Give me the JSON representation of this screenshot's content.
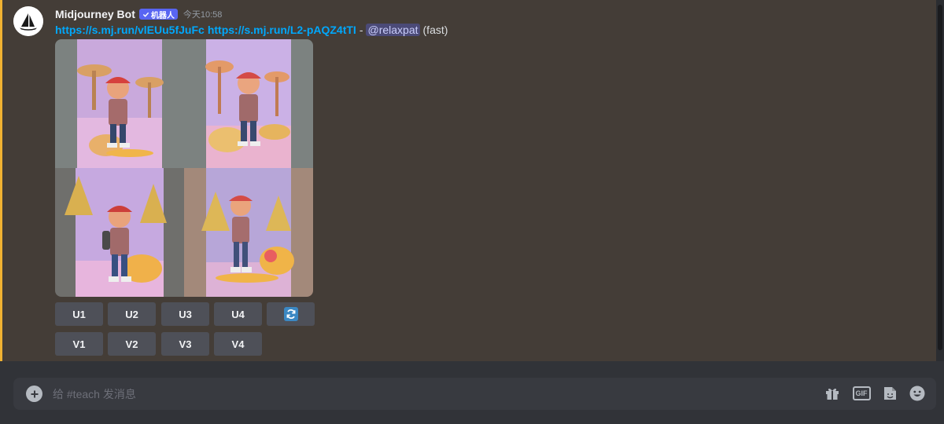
{
  "message": {
    "author": "Midjourney Bot",
    "bot_badge": "机器人",
    "timestamp": "今天10:58",
    "link1": "https://s.mj.run/vlEUu5fJuFc",
    "link2": "https://s.mj.run/L2-pAQZ4tTI",
    "separator": "-",
    "mention": "@relaxpat",
    "mode": "(fast)",
    "image_alt": "3D cartoon boy with red cap and backpack in a fantasy mushroom forest, 2x2 grid"
  },
  "buttons": {
    "upscale": [
      "U1",
      "U2",
      "U3",
      "U4"
    ],
    "variation": [
      "V1",
      "V2",
      "V3",
      "V4"
    ],
    "reroll_icon": "refresh-icon"
  },
  "composer": {
    "placeholder": "给 #teach 发消息",
    "tools": [
      "gift-icon",
      "gif-icon",
      "sticker-icon",
      "emoji-icon"
    ],
    "gif_label": "GIF"
  },
  "colors": {
    "highlight_bg": "#443d37",
    "mention_bar": "#f0b232",
    "link": "#00a8fc",
    "button_bg": "#4e5058",
    "composer_bg": "#383a40",
    "bot_badge": "#5865f2"
  }
}
